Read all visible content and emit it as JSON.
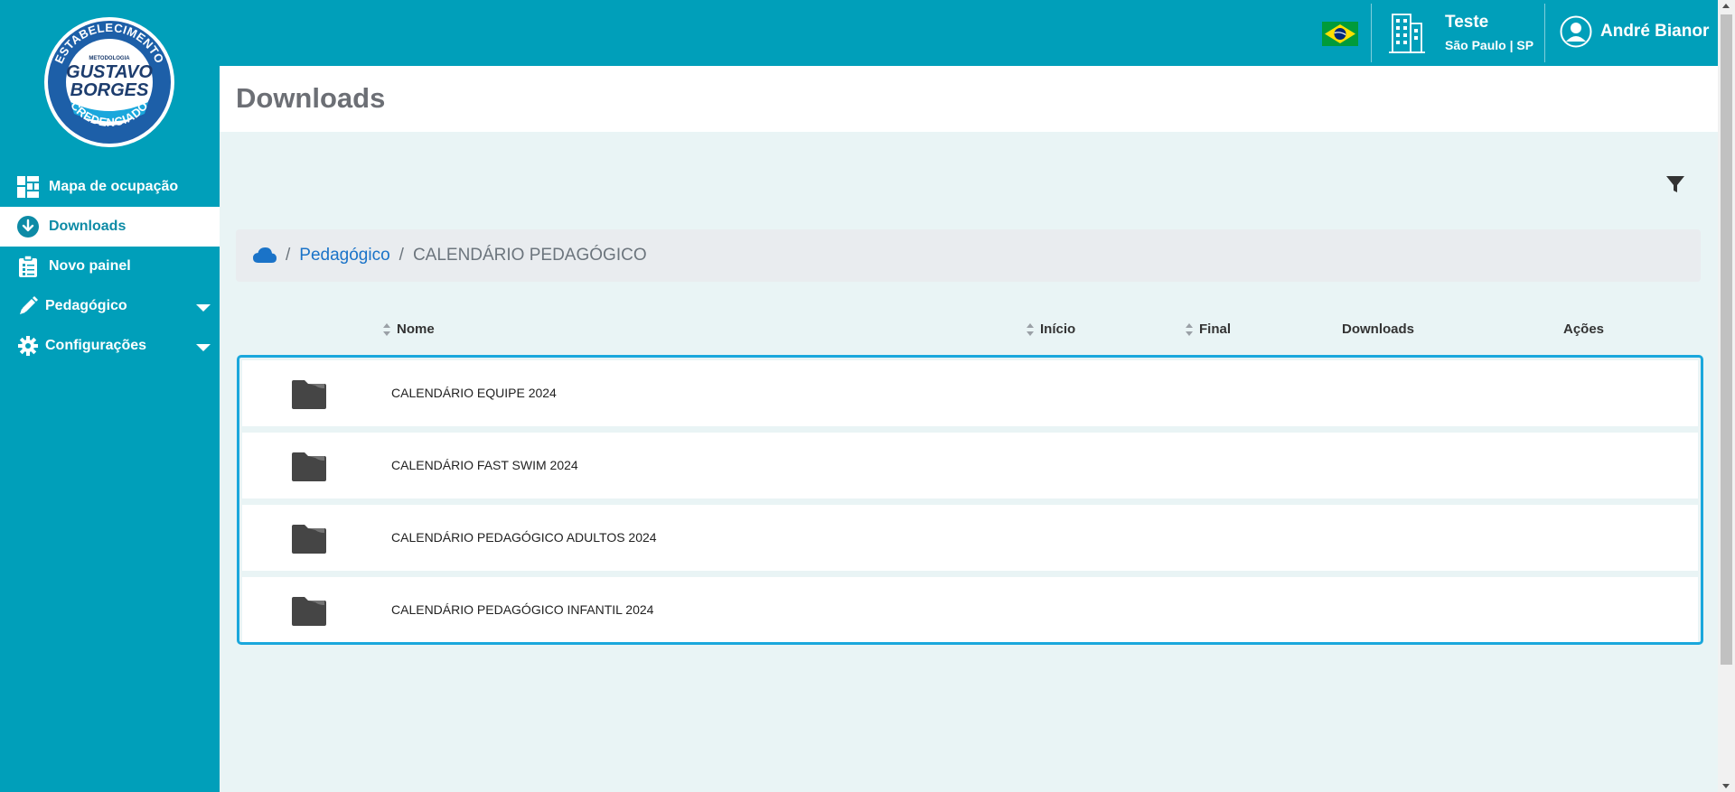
{
  "logo": {
    "top_text": "ESTABELECIMENTO",
    "small_text": "METODOLOGIA",
    "line1": "GUSTAVO",
    "line2": "BORGES",
    "bottom_text": "CREDENCIADO"
  },
  "sidebar": {
    "items": [
      {
        "label": "Mapa de ocupação",
        "icon": "grid-icon",
        "active": false
      },
      {
        "label": "Downloads",
        "icon": "download-circle-icon",
        "active": true
      },
      {
        "label": "Novo painel",
        "icon": "clipboard-icon",
        "active": false
      },
      {
        "label": "Pedagógico",
        "icon": "pencil-icon",
        "active": false,
        "expandable": true
      },
      {
        "label": "Configurações",
        "icon": "gear-icon",
        "active": false,
        "expandable": true
      }
    ]
  },
  "header": {
    "flag": "brazil-flag-icon",
    "school_name": "Teste",
    "school_location": "São Paulo | SP",
    "user_name": "André Bianor"
  },
  "page": {
    "title": "Downloads"
  },
  "breadcrumb": {
    "items": [
      "Pedagógico",
      "CALENDÁRIO PEDAGÓGICO"
    ],
    "separator": "/"
  },
  "table": {
    "columns": [
      "Nome",
      "Início",
      "Final",
      "Downloads",
      "Ações"
    ],
    "rows": [
      {
        "name": "CALENDÁRIO EQUIPE 2024",
        "type": "folder"
      },
      {
        "name": "CALENDÁRIO FAST SWIM 2024",
        "type": "folder"
      },
      {
        "name": "CALENDÁRIO PEDAGÓGICO ADULTOS 2024",
        "type": "folder"
      },
      {
        "name": "CALENDÁRIO PEDAGÓGICO INFANTIL 2024",
        "type": "folder"
      }
    ]
  },
  "colors": {
    "primary": "#009fba",
    "active_text": "#0d8ba6",
    "link": "#1a73c8",
    "highlight_border": "#1aa7dc",
    "content_bg": "#e9f4f5"
  }
}
